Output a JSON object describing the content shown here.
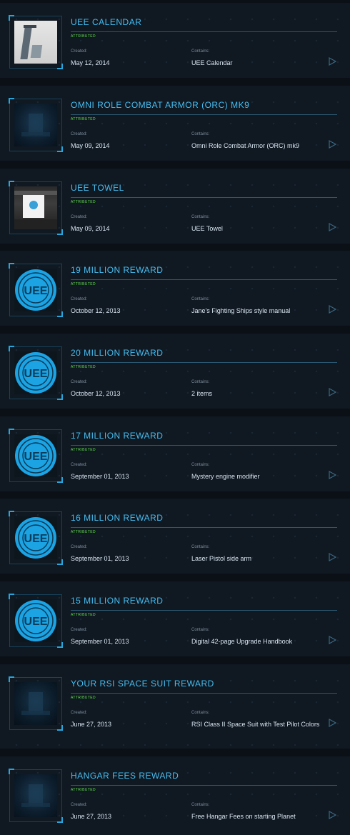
{
  "labels": {
    "attributed": "ATTRIBUTED",
    "created": "Created:",
    "contains": "Contains:"
  },
  "icons": {
    "play": "play-arrow-icon",
    "uee-logo": "uee-emblem-icon"
  },
  "colors": {
    "accent": "#45bdf0",
    "attributed": "#5fe04a",
    "background": "#0a1016"
  },
  "items": [
    {
      "title": "UEE CALENDAR",
      "created": "May 12, 2014",
      "contains": "UEE Calendar",
      "thumb": "calendar"
    },
    {
      "title": "OMNI ROLE COMBAT ARMOR (ORC) MK9",
      "created": "May 09, 2014",
      "contains": "Omni Role Combat Armor (ORC) mk9",
      "thumb": "armor"
    },
    {
      "title": "UEE TOWEL",
      "created": "May 09, 2014",
      "contains": "UEE Towel",
      "thumb": "towel"
    },
    {
      "title": "19 MILLION REWARD",
      "created": "October 12, 2013",
      "contains": "Jane's Fighting Ships style manual",
      "thumb": "logo"
    },
    {
      "title": "20 MILLION REWARD",
      "created": "October 12, 2013",
      "contains": "2 items",
      "thumb": "logo"
    },
    {
      "title": "17 MILLION REWARD",
      "created": "September 01, 2013",
      "contains": "Mystery engine modifier",
      "thumb": "logo"
    },
    {
      "title": "16 MILLION REWARD",
      "created": "September 01, 2013",
      "contains": "Laser Pistol side arm",
      "thumb": "logo"
    },
    {
      "title": "15 MILLION REWARD",
      "created": "September 01, 2013",
      "contains": "Digital 42-page Upgrade Handbook",
      "thumb": "logo"
    },
    {
      "title": "YOUR RSI SPACE SUIT REWARD",
      "created": "June 27, 2013",
      "contains": "RSI Class II Space Suit with Test Pilot Colors",
      "thumb": "suit"
    },
    {
      "title": "HANGAR FEES REWARD",
      "created": "June 27, 2013",
      "contains": "Free Hangar Fees on starting Planet",
      "thumb": "armor"
    }
  ]
}
